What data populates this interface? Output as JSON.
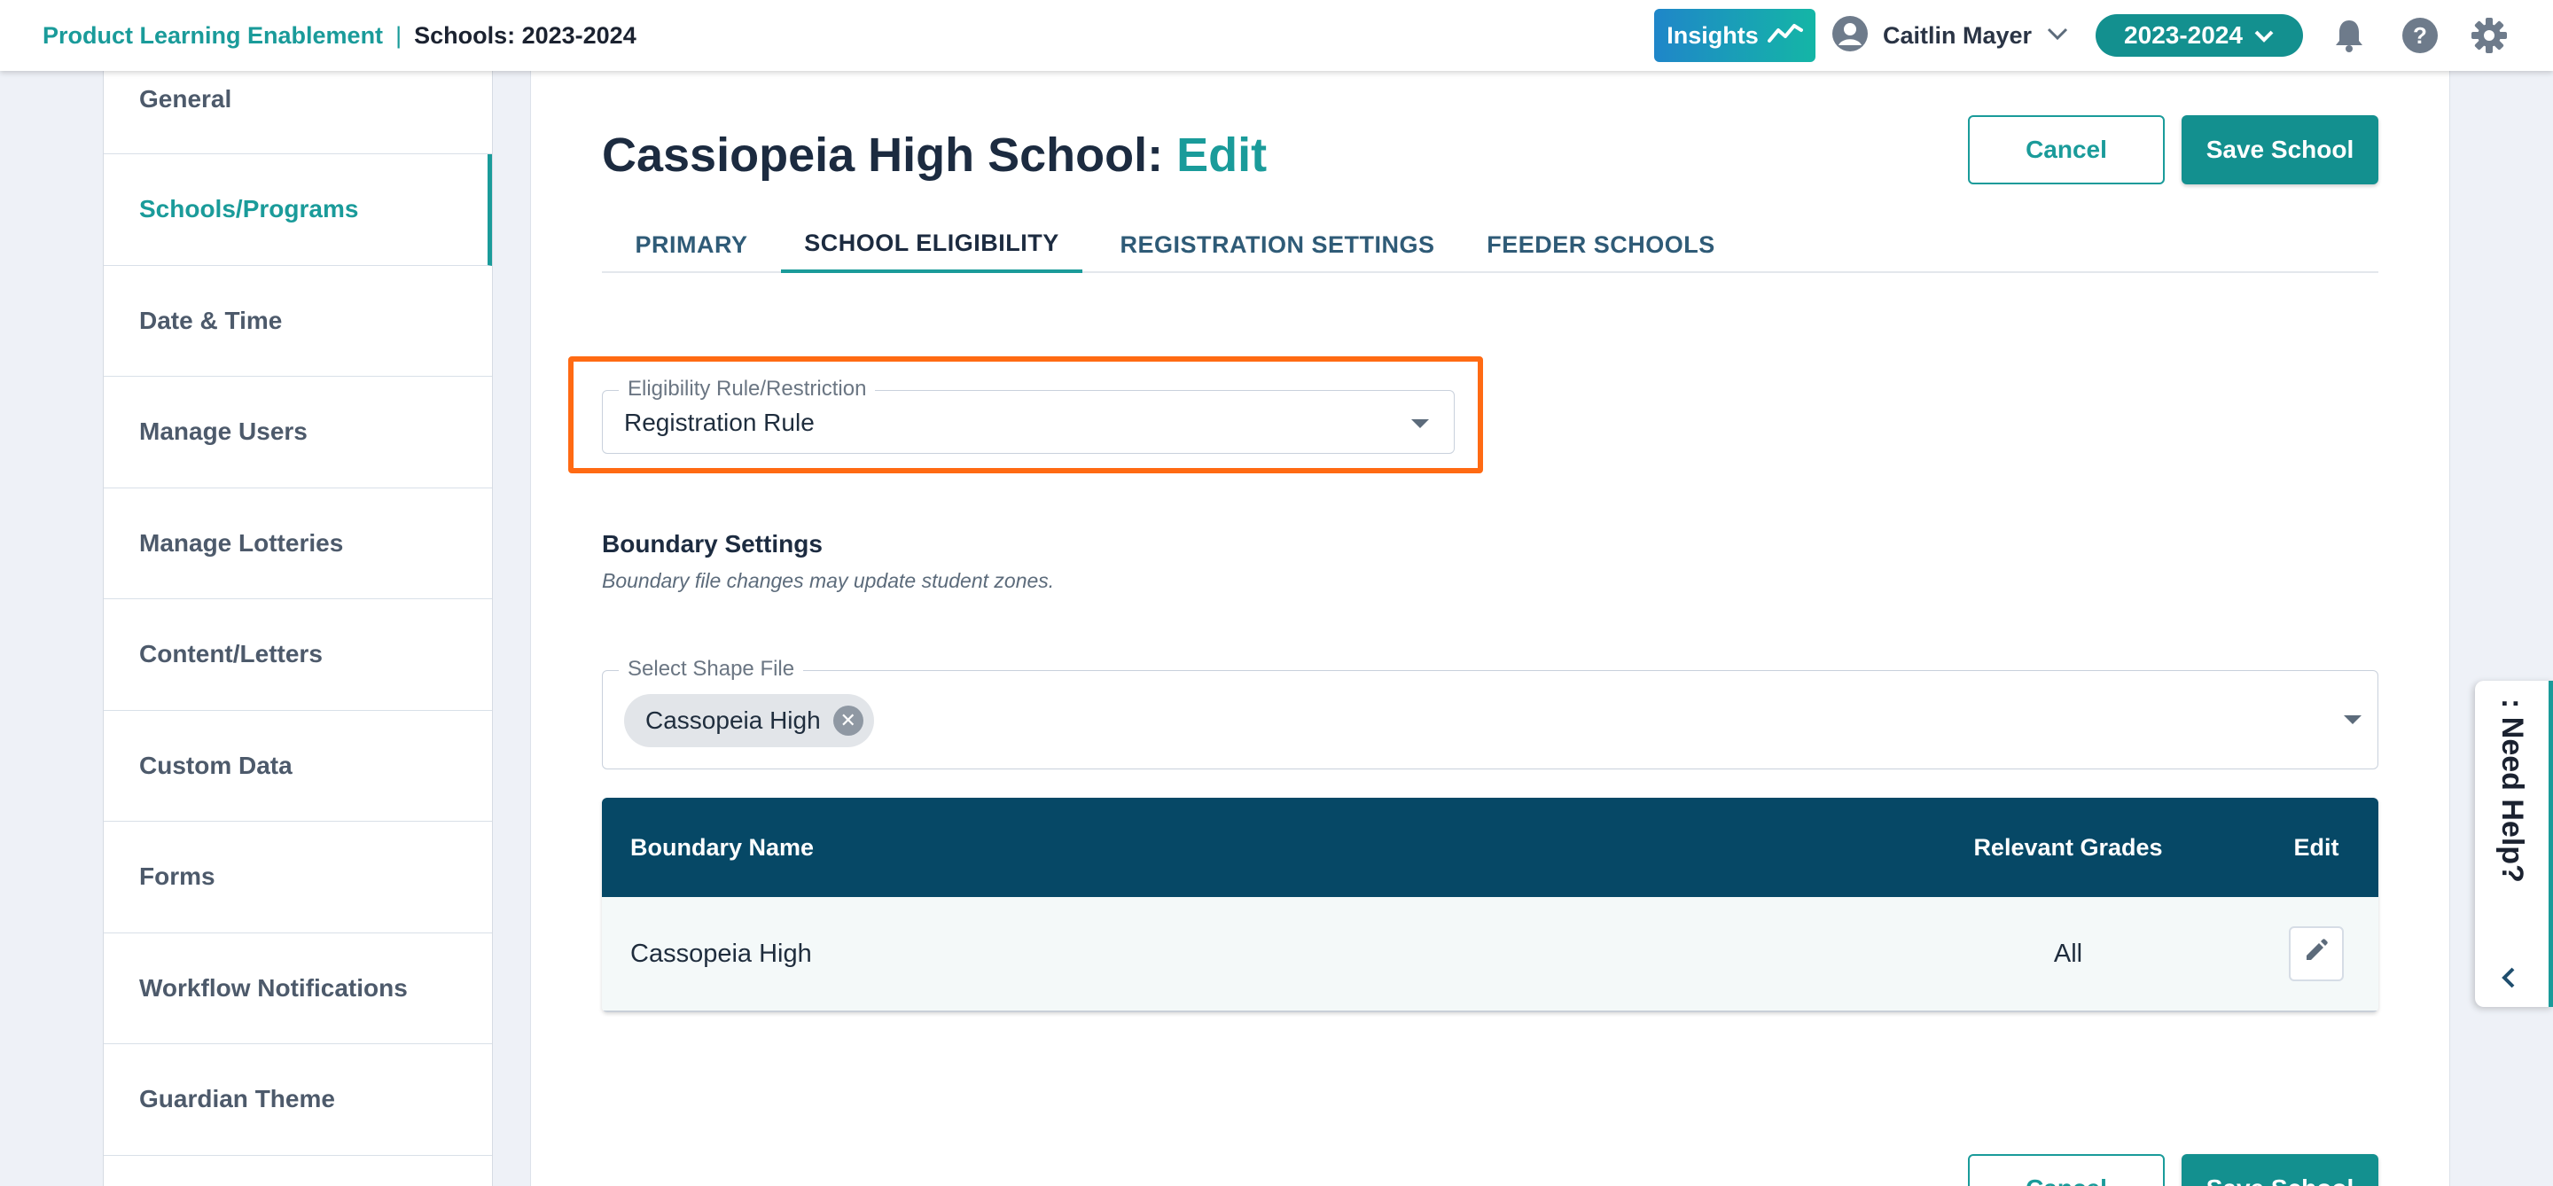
{
  "header": {
    "org_name": "Product Learning Enablement",
    "separator": "|",
    "context": "Schools: 2023-2024",
    "insights_label": "Insights",
    "user_name": "Caitlin Mayer",
    "year_label": "2023-2024"
  },
  "sidebar": {
    "items": [
      {
        "label": "General"
      },
      {
        "label": "Schools/Programs",
        "active": true
      },
      {
        "label": "Date & Time"
      },
      {
        "label": "Manage Users"
      },
      {
        "label": "Manage Lotteries"
      },
      {
        "label": "Content/Letters"
      },
      {
        "label": "Custom Data"
      },
      {
        "label": "Forms"
      },
      {
        "label": "Workflow Notifications"
      },
      {
        "label": "Guardian Theme"
      }
    ]
  },
  "page": {
    "title": "Cassiopeia High School:",
    "title_mode": "Edit",
    "cancel_label": "Cancel",
    "save_label": "Save School",
    "bottom_cancel_label": "Cancel",
    "bottom_save_label": "Save School"
  },
  "tabs": [
    {
      "label": "PRIMARY"
    },
    {
      "label": "SCHOOL ELIGIBILITY",
      "active": true
    },
    {
      "label": "REGISTRATION SETTINGS"
    },
    {
      "label": "FEEDER SCHOOLS"
    }
  ],
  "eligibility": {
    "legend": "Eligibility Rule/Restriction",
    "value": "Registration Rule"
  },
  "boundary": {
    "title": "Boundary Settings",
    "subtitle": "Boundary file changes may update student zones.",
    "shape_legend": "Select Shape File",
    "shape_chip": "Cassopeia High"
  },
  "table": {
    "headers": [
      "Boundary Name",
      "Relevant Grades",
      "Edit"
    ],
    "rows": [
      {
        "name": "Cassopeia High",
        "grades": "All"
      }
    ]
  },
  "help": {
    "label": ": Need Help?"
  },
  "colors": {
    "accent": "#1a9b9a",
    "table_header": "#064866",
    "highlight": "#ff6a13"
  }
}
